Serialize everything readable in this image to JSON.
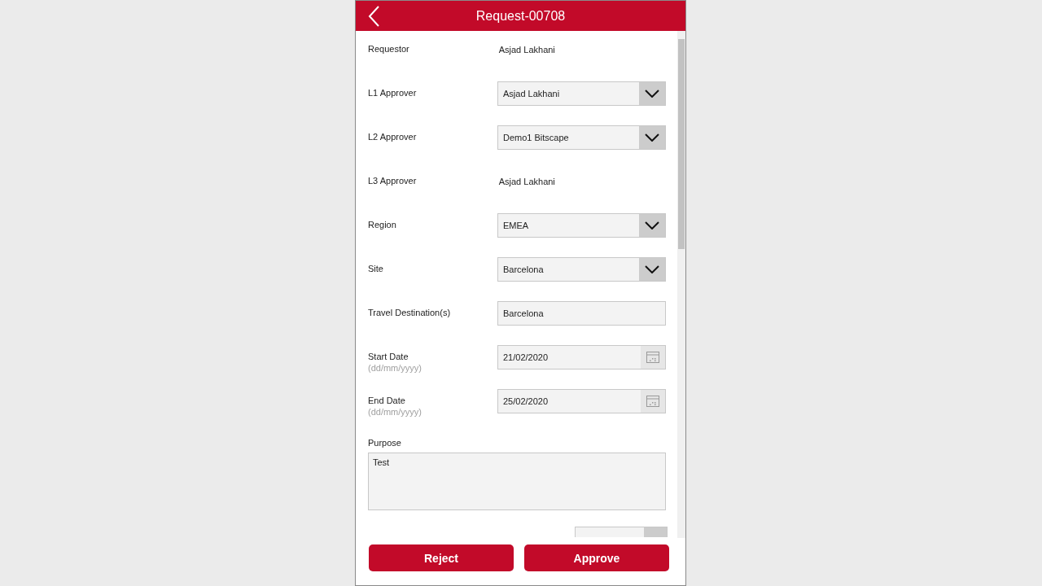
{
  "header": {
    "title": "Request-00708"
  },
  "fields": [
    {
      "kind": "text",
      "label": "Requestor",
      "value": "Asjad Lakhani"
    },
    {
      "kind": "dropdown",
      "label": "L1 Approver",
      "value": "Asjad Lakhani"
    },
    {
      "kind": "dropdown",
      "label": "L2 Approver",
      "value": "Demo1 Bitscape"
    },
    {
      "kind": "text",
      "label": "L3 Approver",
      "value": "Asjad Lakhani"
    },
    {
      "kind": "dropdown",
      "label": "Region",
      "value": "EMEA"
    },
    {
      "kind": "dropdown",
      "label": "Site",
      "value": "Barcelona"
    },
    {
      "kind": "input",
      "label": "Travel Destination(s)",
      "value": "Barcelona"
    },
    {
      "kind": "date",
      "label": "Start Date",
      "hint": "(dd/mm/yyyy)",
      "value": "21/02/2020"
    },
    {
      "kind": "date",
      "label": "End Date",
      "hint": "(dd/mm/yyyy)",
      "value": "25/02/2020"
    },
    {
      "kind": "textarea",
      "label": "Purpose",
      "value": "Test"
    }
  ],
  "buttons": [
    {
      "label": "Reject"
    },
    {
      "label": "Approve"
    }
  ]
}
